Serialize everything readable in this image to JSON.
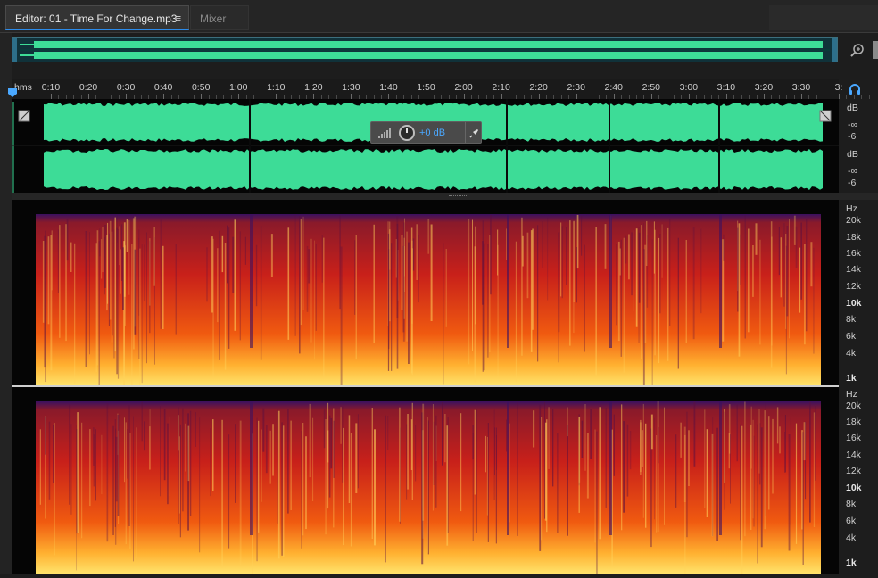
{
  "tabs": {
    "editor_label": "Editor: 01 - Time For Change.mp3",
    "menu_glyph": "≡",
    "mixer_label": "Mixer"
  },
  "ruler": {
    "unit": "hms",
    "labels": [
      "0:10",
      "0:20",
      "0:30",
      "0:40",
      "0:50",
      "1:00",
      "1:10",
      "1:20",
      "1:30",
      "1:40",
      "1:50",
      "2:00",
      "2:10",
      "2:20",
      "2:30",
      "2:40",
      "2:50",
      "3:00",
      "3:10",
      "3:20",
      "3:30",
      "3:"
    ]
  },
  "hud": {
    "volume": "+0 dB"
  },
  "db_scale": {
    "unit": "dB",
    "neg_inf": "-∞",
    "minus6": "-6"
  },
  "hz_scale": {
    "unit": "Hz",
    "labels": [
      "20k",
      "18k",
      "16k",
      "14k",
      "12k",
      "10k",
      "8k",
      "6k",
      "4k",
      "1k"
    ]
  },
  "colors": {
    "waveform": "#3ddc97",
    "accent": "#2d8ceb",
    "spectral_hot": "#ffe36b",
    "spectral_mid": "#e0301a",
    "spectral_cool": "#3a1060"
  },
  "icons": {
    "zoom": "zoom-in-icon",
    "headphones": "headphones-icon",
    "pin": "pin-icon",
    "knob": "volume-knob-icon"
  }
}
